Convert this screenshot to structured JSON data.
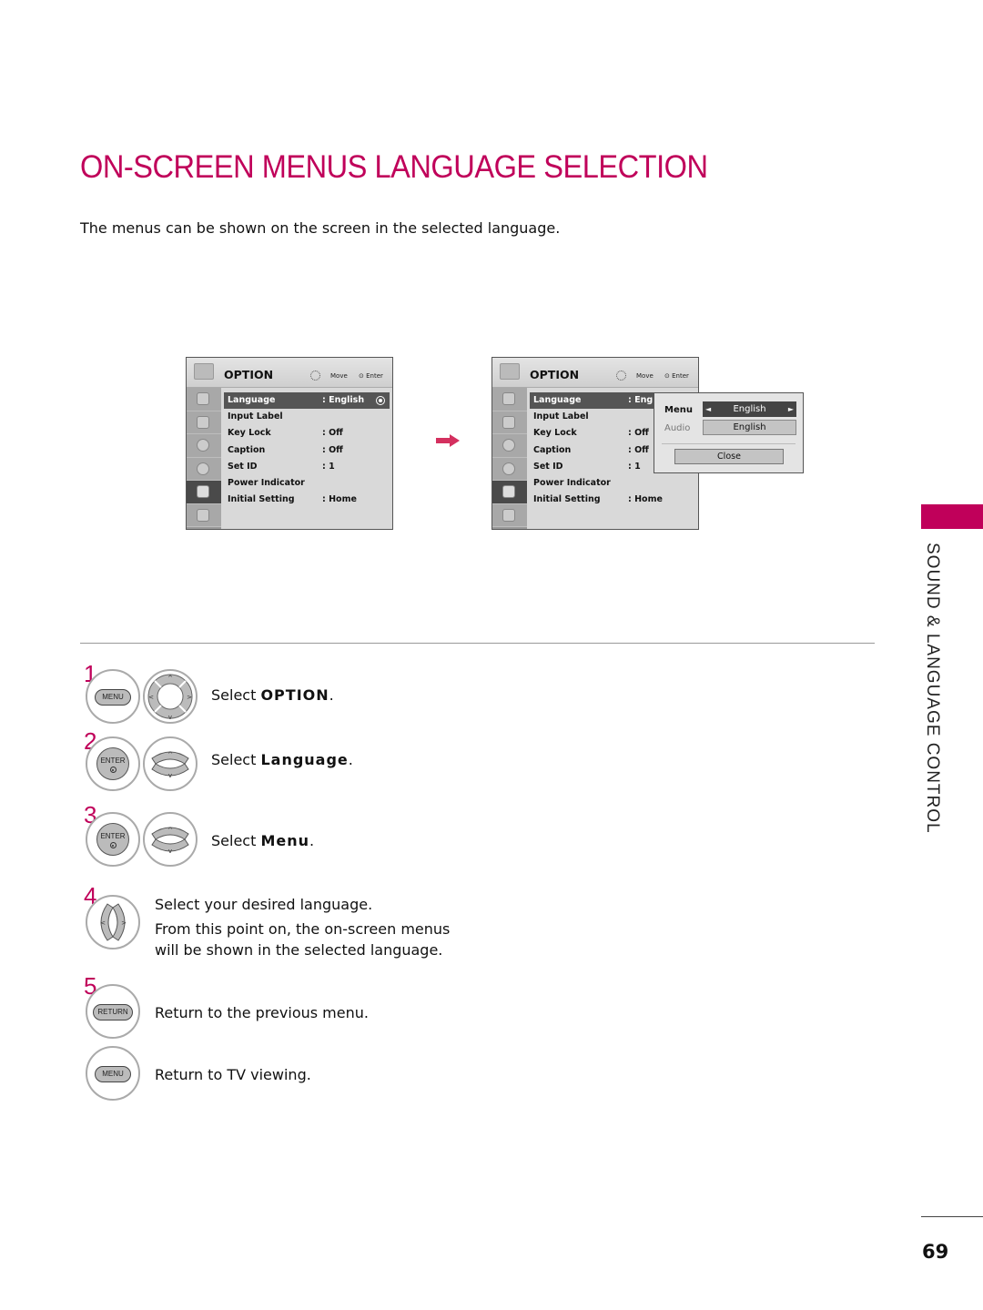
{
  "page": {
    "title": "ON-SCREEN MENUS LANGUAGE SELECTION",
    "subtitle": "The menus can be shown on the screen in the selected language.",
    "section_tab": "SOUND & LANGUAGE CONTROL",
    "page_number": "69",
    "accent_color": "#c0005a"
  },
  "osd_before": {
    "header": {
      "title": "OPTION",
      "move": "Move",
      "enter": "Enter"
    },
    "sidebar_icons": [
      "picture-icon",
      "screen-icon",
      "audio-icon",
      "time-icon",
      "option-icon",
      "lock-icon"
    ],
    "active_sidebar": 4,
    "rows": [
      {
        "label": "Language",
        "value": ": English",
        "selected": true
      },
      {
        "label": "Input Label",
        "value": ""
      },
      {
        "label": "Key Lock",
        "value": ": Off"
      },
      {
        "label": "Caption",
        "value": ": Off"
      },
      {
        "label": "Set ID",
        "value": ": 1"
      },
      {
        "label": "Power Indicator",
        "value": ""
      },
      {
        "label": "Initial Setting",
        "value": ": Home"
      }
    ]
  },
  "osd_after": {
    "header": {
      "title": "OPTION",
      "move": "Move",
      "enter": "Enter"
    },
    "rows": [
      {
        "label": "Language",
        "value": ": Eng",
        "selected": true
      },
      {
        "label": "Input Label",
        "value": ""
      },
      {
        "label": "Key Lock",
        "value": ": Off"
      },
      {
        "label": "Caption",
        "value": ": Off"
      },
      {
        "label": "Set ID",
        "value": ": 1"
      },
      {
        "label": "Power Indicator",
        "value": ""
      },
      {
        "label": "Initial Setting",
        "value": ": Home"
      }
    ],
    "popup": {
      "menu_label": "Menu",
      "menu_value": "English",
      "audio_label": "Audio",
      "audio_value": "English",
      "close_label": "Close",
      "left_arrow": "◄",
      "right_arrow": "►"
    }
  },
  "steps": [
    {
      "num": "1",
      "button": "MENU",
      "text_prefix": "Select ",
      "text_bold": "OPTION",
      "text_suffix": "."
    },
    {
      "num": "2",
      "button": "ENTER",
      "text_prefix": "Select ",
      "text_bold": "Language",
      "text_suffix": "."
    },
    {
      "num": "3",
      "button": "ENTER",
      "text_prefix": "Select ",
      "text_bold": "Menu",
      "text_suffix": "."
    },
    {
      "num": "4",
      "line1": "Select your desired language.",
      "line2": "From this point on, the on-screen menus",
      "line3": "will be shown in the selected language."
    },
    {
      "num": "5",
      "button": "RETURN",
      "text": "Return to the previous menu."
    },
    {
      "button": "MENU",
      "text": "Return to TV viewing."
    }
  ]
}
